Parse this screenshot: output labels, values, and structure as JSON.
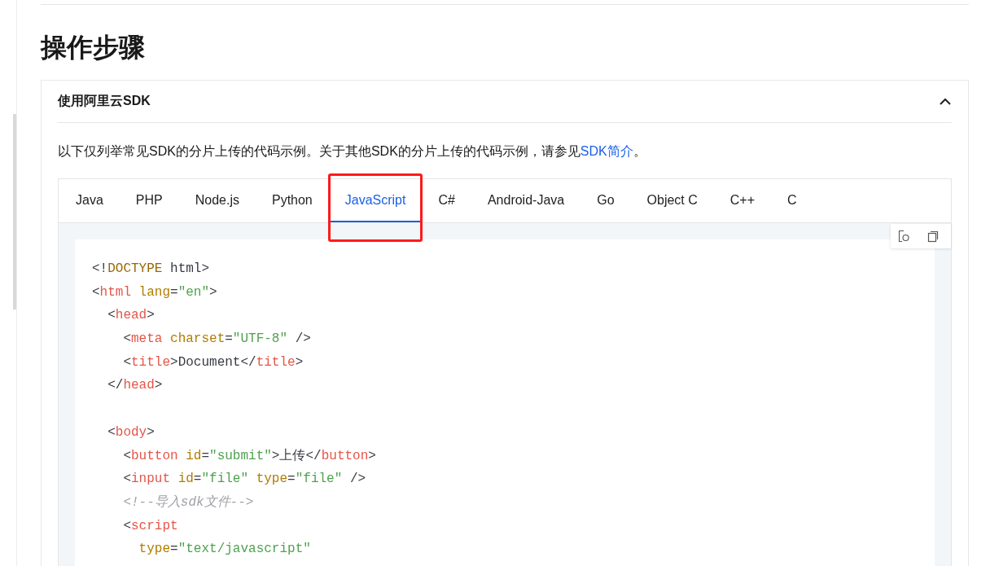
{
  "heading": "操作步骤",
  "section": {
    "title": "使用阿里云SDK",
    "expanded": true,
    "intro": {
      "text": "以下仅列举常见SDK的分片上传的代码示例。关于其他SDK的分片上传的代码示例，请参见",
      "link": "SDK简介",
      "end": "。"
    },
    "tabs": [
      {
        "label": "Java",
        "selected": false,
        "highlighted": false
      },
      {
        "label": "PHP",
        "selected": false,
        "highlighted": false
      },
      {
        "label": "Node.js",
        "selected": false,
        "highlighted": false
      },
      {
        "label": "Python",
        "selected": false,
        "highlighted": false
      },
      {
        "label": "JavaScript",
        "selected": true,
        "highlighted": true
      },
      {
        "label": "C#",
        "selected": false,
        "highlighted": false
      },
      {
        "label": "Android-Java",
        "selected": false,
        "highlighted": false
      },
      {
        "label": "Go",
        "selected": false,
        "highlighted": false
      },
      {
        "label": "Object C",
        "selected": false,
        "highlighted": false
      },
      {
        "label": "C++",
        "selected": false,
        "highlighted": false
      },
      {
        "label": "C",
        "selected": false,
        "highlighted": false
      }
    ],
    "code": [
      {
        "kind": "code",
        "tokens": [
          {
            "kind": "punct",
            "text": "<!"
          },
          {
            "kind": "keyword",
            "text": "DOCTYPE"
          },
          {
            "kind": "punct",
            "text": " html>"
          }
        ]
      },
      {
        "kind": "code",
        "tokens": [
          {
            "kind": "punct",
            "text": "<"
          },
          {
            "kind": "tag",
            "text": "html"
          },
          {
            "kind": "attr",
            "text": " lang"
          },
          {
            "kind": "punct",
            "text": "="
          },
          {
            "kind": "string",
            "text": "\"en\""
          },
          {
            "kind": "punct",
            "text": ">"
          }
        ]
      },
      {
        "kind": "code",
        "tokens": [
          {
            "kind": "punct",
            "text": "  <"
          },
          {
            "kind": "tag",
            "text": "head"
          },
          {
            "kind": "punct",
            "text": ">"
          }
        ]
      },
      {
        "kind": "code",
        "tokens": [
          {
            "kind": "punct",
            "text": "    <"
          },
          {
            "kind": "tag",
            "text": "meta"
          },
          {
            "kind": "attr",
            "text": " charset"
          },
          {
            "kind": "punct",
            "text": "="
          },
          {
            "kind": "string",
            "text": "\"UTF-8\""
          },
          {
            "kind": "punct",
            "text": " />"
          }
        ]
      },
      {
        "kind": "code",
        "tokens": [
          {
            "kind": "punct",
            "text": "    <"
          },
          {
            "kind": "tag",
            "text": "title"
          },
          {
            "kind": "punct",
            "text": ">Document</"
          },
          {
            "kind": "tag",
            "text": "title"
          },
          {
            "kind": "punct",
            "text": ">"
          }
        ]
      },
      {
        "kind": "code",
        "tokens": [
          {
            "kind": "punct",
            "text": "  </"
          },
          {
            "kind": "tag",
            "text": "head"
          },
          {
            "kind": "punct",
            "text": ">"
          }
        ]
      },
      {
        "kind": "blank"
      },
      {
        "kind": "code",
        "tokens": [
          {
            "kind": "punct",
            "text": "  <"
          },
          {
            "kind": "tag",
            "text": "body"
          },
          {
            "kind": "punct",
            "text": ">"
          }
        ]
      },
      {
        "kind": "code",
        "tokens": [
          {
            "kind": "punct",
            "text": "    <"
          },
          {
            "kind": "tag",
            "text": "button"
          },
          {
            "kind": "attr",
            "text": " id"
          },
          {
            "kind": "punct",
            "text": "="
          },
          {
            "kind": "string",
            "text": "\"submit\""
          },
          {
            "kind": "punct",
            "text": ">上传</"
          },
          {
            "kind": "tag",
            "text": "button"
          },
          {
            "kind": "punct",
            "text": ">"
          }
        ]
      },
      {
        "kind": "code",
        "tokens": [
          {
            "kind": "punct",
            "text": "    <"
          },
          {
            "kind": "tag",
            "text": "input"
          },
          {
            "kind": "attr",
            "text": " id"
          },
          {
            "kind": "punct",
            "text": "="
          },
          {
            "kind": "string",
            "text": "\"file\""
          },
          {
            "kind": "attr",
            "text": " type"
          },
          {
            "kind": "punct",
            "text": "="
          },
          {
            "kind": "string",
            "text": "\"file\""
          },
          {
            "kind": "punct",
            "text": " />"
          }
        ]
      },
      {
        "kind": "code",
        "tokens": [
          {
            "kind": "comment",
            "text": "    <!--导入sdk文件-->"
          }
        ]
      },
      {
        "kind": "code",
        "tokens": [
          {
            "kind": "punct",
            "text": "    <"
          },
          {
            "kind": "tag",
            "text": "script"
          }
        ]
      },
      {
        "kind": "code",
        "tokens": [
          {
            "kind": "attr",
            "text": "      type"
          },
          {
            "kind": "punct",
            "text": "="
          },
          {
            "kind": "string",
            "text": "\"text/javascript\""
          }
        ]
      }
    ]
  }
}
